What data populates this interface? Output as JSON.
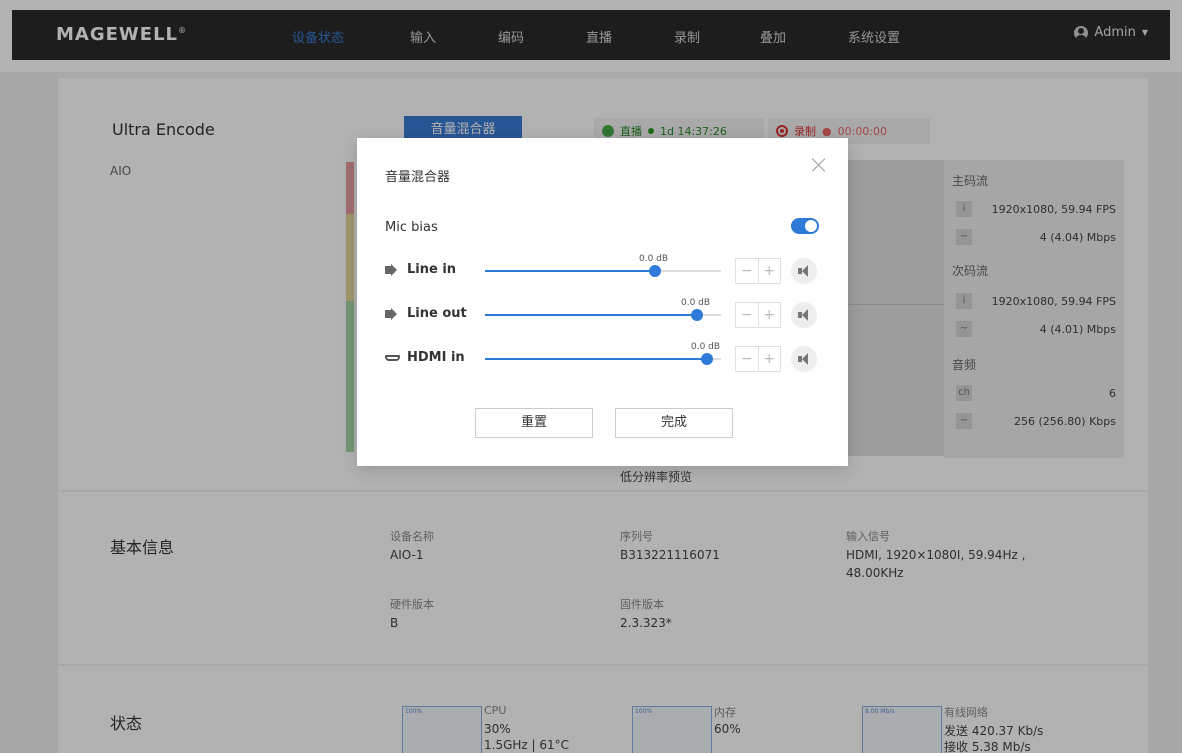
{
  "nav": {
    "logo": "MAGEWELL",
    "items": [
      "设备状态",
      "输入",
      "编码",
      "直播",
      "录制",
      "叠加",
      "系统设置"
    ],
    "user": "Admin"
  },
  "device": {
    "name": "Ultra Encode",
    "model": "AIO",
    "mixer_button": "音量混合器",
    "live_label": "直播",
    "live_time": "1d 14:37:26",
    "record_label": "录制",
    "record_time": "00:00:00",
    "preview_label": "低分辨率预览"
  },
  "streams": {
    "main_head": "主码流",
    "main_res": "1920x1080, 59.94 FPS",
    "main_rate": "4 (4.04) Mbps",
    "sub_head": "次码流",
    "sub_res": "1920x1080, 59.94 FPS",
    "sub_rate": "4 (4.01) Mbps",
    "audio_head": "音频",
    "audio_ch_label": "ch",
    "audio_ch": "6",
    "audio_rate": "256 (256.80) Kbps"
  },
  "basic": {
    "title": "基本信息",
    "device_name_label": "设备名称",
    "device_name": "AIO-1",
    "serial_label": "序列号",
    "serial": "B313221116071",
    "input_label": "输入信号",
    "input_line1": "HDMI, 1920×1080I, 59.94Hz ,",
    "input_line2": "48.00KHz",
    "hw_label": "硬件版本",
    "hw": "B",
    "fw_label": "固件版本",
    "fw": "2.3.323*"
  },
  "status": {
    "title": "状态",
    "cpu_label": "CPU",
    "cpu_usage": "30%",
    "cpu_freq": "1.5GHz | 61°C",
    "mem_label": "内存",
    "mem_usage": "60%",
    "net_label": "有线网络",
    "net_send": "发送 420.37 Kb/s",
    "net_recv": "接收 5.38 Mb/s",
    "graph_cpu_tag": "100%",
    "graph_mem_tag": "100%",
    "graph_net_tag": "8.00 Mb/s"
  },
  "modal": {
    "title": "音量混合器",
    "mic_bias_label": "Mic bias",
    "mic_bias_on": true,
    "channels": [
      {
        "label": "Line in",
        "db": "0.0 dB",
        "level": 0.72
      },
      {
        "label": "Line out",
        "db": "0.0 dB",
        "level": 0.9
      },
      {
        "label": "HDMI in",
        "db": "0.0 dB",
        "level": 0.94
      }
    ],
    "reset_label": "重置",
    "done_label": "完成"
  },
  "colors": {
    "accent": "#2d7ad8",
    "nav_bg": "#2a2a2a",
    "live_green": "#2a8a2a",
    "record_red": "#dd3333"
  }
}
